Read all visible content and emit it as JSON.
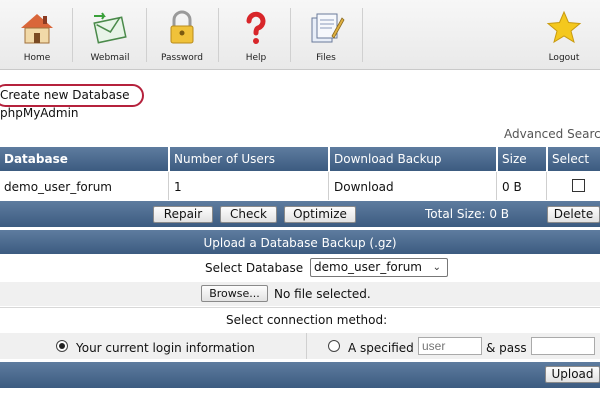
{
  "toolbar": {
    "items": [
      {
        "label": "Home",
        "icon": "home-icon"
      },
      {
        "label": "Webmail",
        "icon": "webmail-icon"
      },
      {
        "label": "Password",
        "icon": "padlock-icon"
      },
      {
        "label": "Help",
        "icon": "question-mark-icon"
      },
      {
        "label": "Files",
        "icon": "files-icon"
      },
      {
        "label": "Logout",
        "icon": "star-icon"
      }
    ]
  },
  "links": {
    "create_db": "Create new Database",
    "phpmyadmin": "phpMyAdmin",
    "advanced_search": "Advanced Search"
  },
  "table": {
    "headers": [
      "Database",
      "Number of Users",
      "Download Backup",
      "Size",
      "Select"
    ],
    "row": {
      "database": "demo_user_forum",
      "users": "1",
      "download": "Download",
      "size": "0 B"
    }
  },
  "actions": {
    "repair": "Repair",
    "check": "Check",
    "optimize": "Optimize",
    "total_size": "Total Size: 0 B",
    "delete": "Delete"
  },
  "upload": {
    "title": "Upload a Database Backup (.gz)",
    "select_label": "Select Database",
    "selected_db": "demo_user_forum",
    "browse": "Browse...",
    "no_file": "No file selected.",
    "connection_label": "Select connection method:",
    "current_login": "Your current login information",
    "specified": "A specified",
    "user_placeholder": "user",
    "and_pass": "& pass",
    "upload_button": "Upload"
  },
  "colors": {
    "header_blue": "#3c5b80",
    "highlight_ring": "#b5213c"
  }
}
